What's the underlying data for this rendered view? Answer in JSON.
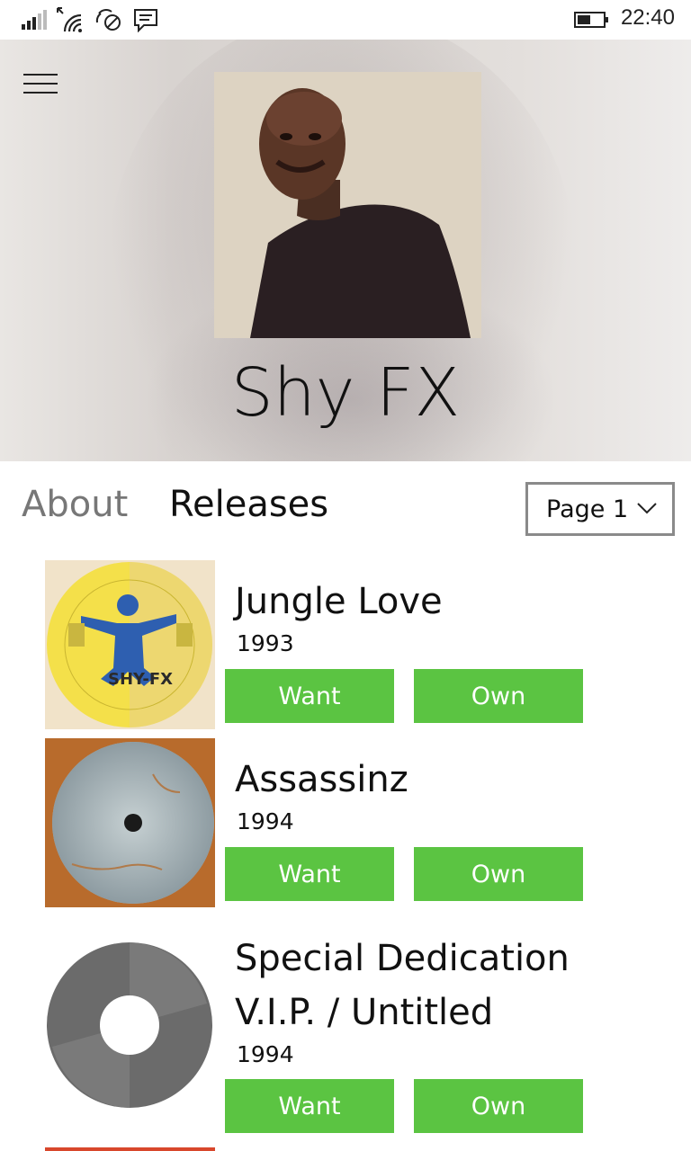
{
  "status_bar": {
    "time": "22:40",
    "icons": [
      "signal-icon",
      "wifi-icon",
      "quiet-hours-icon",
      "message-icon",
      "battery-icon"
    ]
  },
  "header": {
    "menu_icon": "hamburger-icon",
    "artist_name": "Shy FX"
  },
  "tabs": [
    {
      "label": "About",
      "selected": false
    },
    {
      "label": "Releases",
      "selected": true
    }
  ],
  "page_select": {
    "value": "Page 1",
    "icon": "chevron-down-icon"
  },
  "releases": [
    {
      "title": "Jungle Love",
      "year": "1993",
      "want_label": "Want",
      "own_label": "Own"
    },
    {
      "title": "Assassinz",
      "year": "1994",
      "want_label": "Want",
      "own_label": "Own"
    },
    {
      "title_line1": "Special Dedication",
      "title_line2": "V.I.P. / Untitled",
      "year": "1994",
      "want_label": "Want",
      "own_label": "Own"
    }
  ],
  "colors": {
    "accent_green": "#5bc442",
    "tab_inactive": "#777777",
    "text": "#111111"
  }
}
